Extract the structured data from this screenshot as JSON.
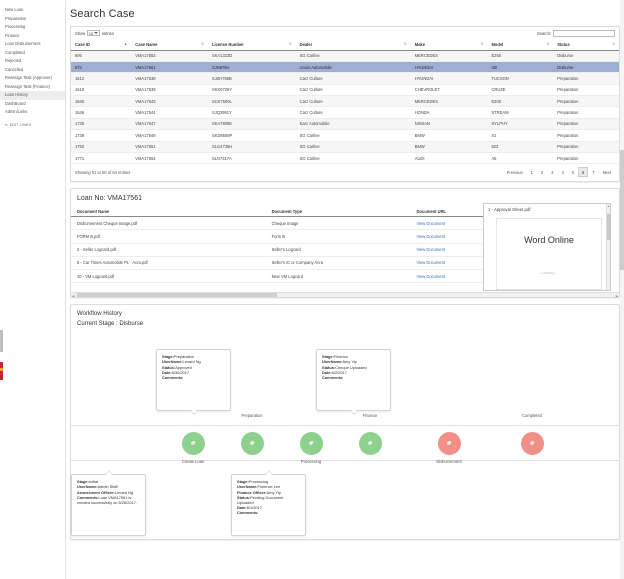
{
  "sidebar": {
    "items": [
      {
        "label": "New Loan",
        "active": false
      },
      {
        "label": "Preparation",
        "active": false
      },
      {
        "label": "Processing",
        "active": false
      },
      {
        "label": "Finance",
        "active": false
      },
      {
        "label": "Loan Disbursement",
        "active": false
      },
      {
        "label": "Completed",
        "active": false
      },
      {
        "label": "Rejected",
        "active": false
      },
      {
        "label": "Cancelled",
        "active": false
      },
      {
        "label": "Reassign Task (Approver)",
        "active": false
      },
      {
        "label": "Reassign Task (Finance)",
        "active": false
      },
      {
        "label": "Loan History",
        "active": true
      },
      {
        "label": "DashBoard",
        "active": false
      },
      {
        "label": "Admin/Links",
        "active": false
      }
    ],
    "edit_links": "EDIT LINKS"
  },
  "page": {
    "title": "Search Case"
  },
  "datatable": {
    "show_label": "Show",
    "entries_label": "entries",
    "page_length": "10",
    "search_label": "Search:",
    "search_value": "",
    "search_placeholder": "",
    "columns": [
      "Case ID",
      "Case Name",
      "License Number",
      "Dealer",
      "Make",
      "Model",
      "Status"
    ],
    "sorted_column": "Case ID",
    "sort_direction": "asc",
    "rows": [
      {
        "case_id": "906",
        "case_name": "VMA17552",
        "license": "SKA1323D",
        "dealer": "SG Carline",
        "make": "MERCEDES",
        "model": "E250",
        "status": "Disburse"
      },
      {
        "case_id": "973",
        "case_name": "VMA17561",
        "license": "SJN679A",
        "dealer": "Union Automobile",
        "make": "HYUNDAI",
        "model": "I30",
        "status": "Disburse"
      },
      {
        "case_id": "1612",
        "case_name": "VMA17538",
        "license": "SJZH755B",
        "dealer": "Carz Culture",
        "make": "HYUNDAI",
        "model": "TUCSON",
        "status": "Preparation"
      },
      {
        "case_id": "1618",
        "case_name": "VMA17539",
        "license": "SKK0726Y",
        "dealer": "Carz Culture",
        "make": "CHEVROLET",
        "model": "CRUZE",
        "status": "Preparation"
      },
      {
        "case_id": "1640",
        "case_name": "VMA17543",
        "license": "SCK7500L",
        "dealer": "Carz Culture",
        "make": "MERCEDES",
        "model": "E200",
        "status": "Preparation"
      },
      {
        "case_id": "1646",
        "case_name": "VMA17544",
        "license": "SJQ3991Y",
        "dealer": "Carz Culture",
        "make": "HONDA",
        "model": "STREAM",
        "status": "Preparation"
      },
      {
        "case_id": "1725",
        "case_name": "VMA17547",
        "license": "SKA7905E",
        "dealer": "Karz Automobile",
        "make": "NISSAN",
        "model": "SYLPHY",
        "status": "Preparation"
      },
      {
        "case_id": "1738",
        "case_name": "VMA17549",
        "license": "SKD6559P",
        "dealer": "SG Carline",
        "make": "BMW",
        "model": "X1",
        "status": "Preparation"
      },
      {
        "case_id": "1750",
        "case_name": "VMA17551",
        "license": "SLG4735H",
        "dealer": "SG Carline",
        "make": "BMW",
        "model": "523",
        "status": "Preparation"
      },
      {
        "case_id": "1771",
        "case_name": "VMA17554",
        "license": "SLN7317A",
        "dealer": "SG Carline",
        "make": "AUDI",
        "model": "A5",
        "status": "Preparation"
      }
    ],
    "selected_row_index": 1,
    "info": "Showing 51 to 60 of 64 entries",
    "pagination": {
      "previous": "Previous",
      "pages": [
        "1",
        "2",
        "3",
        "4",
        "5",
        "6",
        "7"
      ],
      "current": "6",
      "next": "Next"
    }
  },
  "documents": {
    "loan_no_label": "Loan No: VMA17561",
    "columns": [
      "Document Name",
      "Document Type",
      "Document URL"
    ],
    "link_label": "View Document",
    "rows": [
      {
        "name": "Disbursement Cheque Image.pdf",
        "type": "Cheque Image"
      },
      {
        "name": "FORM B.pdf",
        "type": "Form B"
      },
      {
        "name": "2 - Seller Logcard.pdf",
        "type": "Seller's Logcard"
      },
      {
        "name": "5 - Car Times Automobile PL - Acra.pdf",
        "type": "Seller's IC or Company Acra"
      },
      {
        "name": "10 - VM Logcard.pdf",
        "type": "New VM Logcard"
      }
    ],
    "viewer": {
      "title": "1 - Approval Sheet.pdf",
      "brand": "Word Online",
      "dots": "· ·",
      "loading": "Loading..."
    }
  },
  "workflow": {
    "title": "Workflow History",
    "current_stage": "Current Stage : Disburse",
    "nodes": [
      {
        "label": "Create Loan",
        "position": "bottom",
        "color": "green"
      },
      {
        "label": "Preparation",
        "position": "top",
        "color": "green"
      },
      {
        "label": "Processing",
        "position": "bottom",
        "color": "green"
      },
      {
        "label": "Finance",
        "position": "top",
        "color": "green"
      },
      {
        "label": "Disbursement",
        "position": "bottom",
        "color": "red"
      },
      {
        "label": "Completed",
        "position": "top",
        "color": "red"
      }
    ],
    "colors": {
      "green": "#8ed08e",
      "red": "#f09088"
    },
    "cards": [
      {
        "id": "preparation",
        "lines": [
          {
            "k": "Stage:",
            "v": "Preparation"
          },
          {
            "k": "UserName:",
            "v": "Lenard Ng"
          },
          {
            "k": "Status:",
            "v": "Approved"
          },
          {
            "k": "Date:",
            "v": "5/30/2017"
          },
          {
            "k": "Comments:",
            "v": ""
          }
        ]
      },
      {
        "id": "finance",
        "lines": [
          {
            "k": "Stage:",
            "v": "Finance"
          },
          {
            "k": "UserName:",
            "v": "Amy Yip"
          },
          {
            "k": "Status:",
            "v": "Cheque Uploaded"
          },
          {
            "k": "Date:",
            "v": "6/2/2017"
          },
          {
            "k": "Comments:",
            "v": ""
          }
        ]
      },
      {
        "id": "initial",
        "lines": [
          {
            "k": "Stage:",
            "v": "Initial"
          },
          {
            "k": "UserName:",
            "v": "Admin Staff"
          },
          {
            "k": "Assessment Officer:",
            "v": "Lenard Ng"
          },
          {
            "k": "Comments:",
            "v": "Loan VMA17561 is created successfully on 5/26/2017."
          }
        ]
      },
      {
        "id": "processing",
        "lines": [
          {
            "k": "Stage:",
            "v": "Processing"
          },
          {
            "k": "UserName:",
            "v": "Florence Lee"
          },
          {
            "k": "Finance Officer:",
            "v": "Amy Yip"
          },
          {
            "k": "Status:",
            "v": "Pending Document Uploaded"
          },
          {
            "k": "Date:",
            "v": "6/1/2017"
          },
          {
            "k": "Comments:",
            "v": ""
          }
        ]
      }
    ]
  }
}
